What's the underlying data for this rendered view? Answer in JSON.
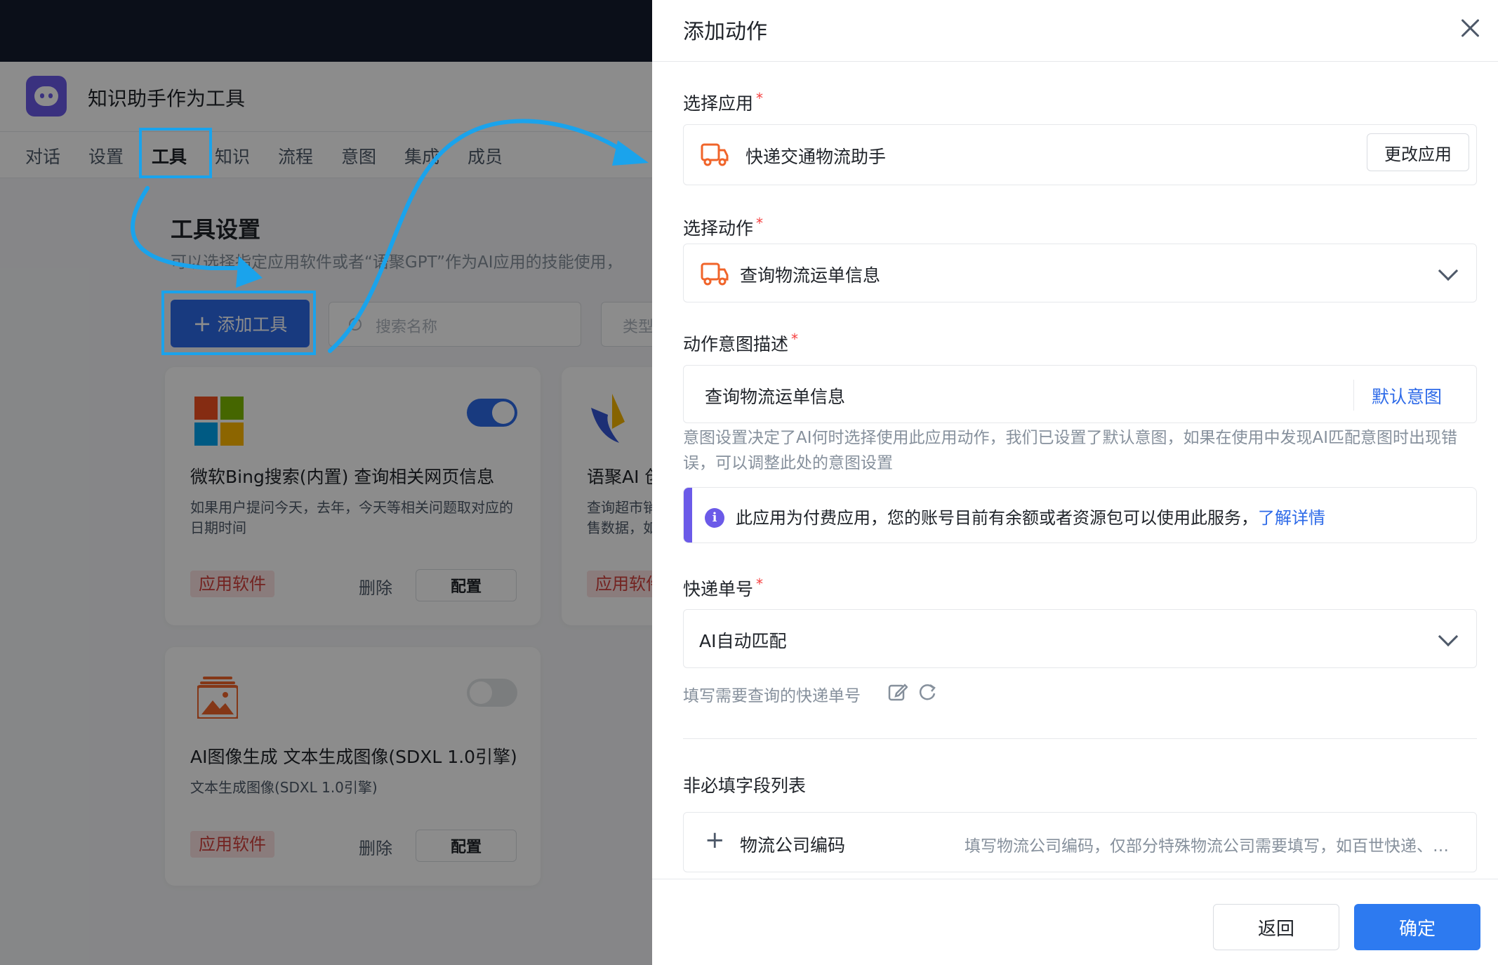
{
  "app": {
    "title": "知识助手作为工具",
    "nav_tabs": [
      "对话",
      "设置",
      "工具",
      "知识",
      "流程",
      "意图",
      "集成",
      "成员"
    ],
    "active_tab": "工具"
  },
  "tools_page": {
    "section_title": "工具设置",
    "section_desc": "可以选择指定应用软件或者“语聚GPT”作为AI应用的技能使用，",
    "add_button": "添加工具",
    "add_icon": "+",
    "search_placeholder": "搜索名称",
    "type_filter": "类型",
    "cards": [
      {
        "title": "微软Bing搜索(内置) 查询相关网页信息",
        "desc": "如果用户提问今天，去年，今天等相关问题取对应的日期时间",
        "tag": "应用软件",
        "delete": "删除",
        "config": "配置",
        "enabled": true,
        "icon": "windows-logo-icon"
      },
      {
        "title": "语聚AI 创",
        "desc": "查询超市销售数据，如果问题中有",
        "tag": "应用软件",
        "icon": "yuju-bird-icon"
      },
      {
        "title": "AI图像生成 文本生成图像(SDXL 1.0引擎)",
        "desc": "文本生成图像(SDXL 1.0引擎)",
        "tag": "应用软件",
        "delete": "删除",
        "config": "配置",
        "enabled": false,
        "icon": "image-gallery-icon"
      }
    ]
  },
  "drawer": {
    "title": "添加动作",
    "select_app": {
      "label": "选择应用",
      "required": "*",
      "app_name": "快递交通物流助手",
      "change_button": "更改应用"
    },
    "select_action": {
      "label": "选择动作",
      "required": "*",
      "value": "查询物流运单信息"
    },
    "intent": {
      "label": "动作意图描述",
      "required": "*",
      "value": "查询物流运单信息",
      "default_link": "默认意图",
      "hint": "意图设置决定了AI何时选择使用此应用动作，我们已设置了默认意图，如果在使用中发现AI匹配意图时出现错误，可以调整此处的意图设置"
    },
    "notice": {
      "icon": "i",
      "text": "此应用为付费应用，您的账号目前有余额或者资源包可以使用此服务，",
      "link": "了解详情"
    },
    "tracking": {
      "label": "快递单号",
      "required": "*",
      "value": "AI自动匹配",
      "hint": "填写需要查询的快递单号"
    },
    "optional_section": {
      "title": "非必填字段列表",
      "items": [
        {
          "label": "物流公司编码",
          "desc": "填写物流公司编码，仅部分特殊物流公司需要填写，如百世快递、顺丰快递等"
        }
      ]
    },
    "footer": {
      "back": "返回",
      "confirm": "确定"
    }
  },
  "colors": {
    "primary": "#2d6ae8",
    "brand_purple": "#6b5ae8",
    "highlight": "#1aa3ec",
    "tag_red": "#d2413c",
    "required_red": "#f53f3f",
    "truck_orange": "#f0642a"
  }
}
